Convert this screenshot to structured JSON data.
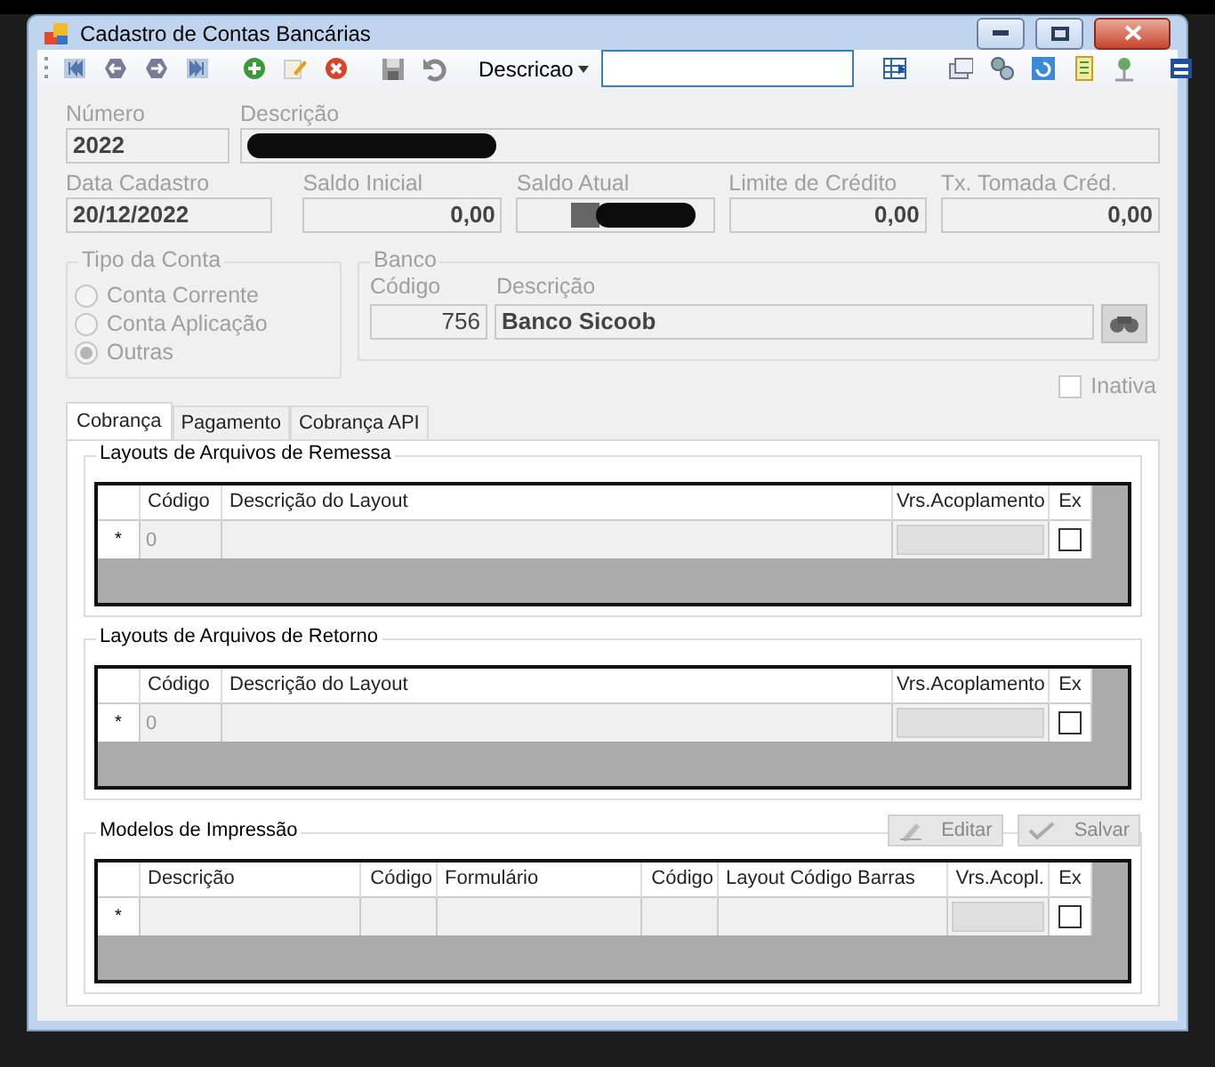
{
  "window": {
    "title": "Cadastro de Contas Bancárias"
  },
  "toolbar": {
    "search_field": {
      "label": "Descricao"
    }
  },
  "fields": [
    {
      "label": "Número",
      "kind": "text",
      "value": "2022"
    },
    {
      "label": "Descrição",
      "kind": "redacted"
    },
    {
      "label": "Data Cadastro",
      "kind": "text",
      "value": "20/12/2022"
    },
    {
      "label": "Saldo Inicial",
      "kind": "amount",
      "value": "0,00"
    },
    {
      "label": "Saldo Atual",
      "kind": "redacted"
    },
    {
      "label": "Limite de Crédito",
      "kind": "amount",
      "value": "0,00"
    },
    {
      "label": "Tx. Tomada Créd.",
      "kind": "amount",
      "value": "0,00"
    }
  ],
  "tipo_conta": {
    "title": "Tipo da Conta",
    "options": [
      {
        "label": "Conta Corrente",
        "selected": false
      },
      {
        "label": "Conta Aplicação",
        "selected": false
      },
      {
        "label": "Outras",
        "selected": true
      }
    ]
  },
  "banco": {
    "title": "Banco",
    "codigo_label": "Código",
    "descricao_label": "Descrição",
    "codigo": "756",
    "descricao": "Banco Sicoob"
  },
  "inativa": {
    "label": "Inativa",
    "checked": false
  },
  "tabs": [
    {
      "label": "Cobrança",
      "selected": true
    },
    {
      "label": "Pagamento",
      "selected": false
    },
    {
      "label": "Cobrança API",
      "selected": false
    }
  ],
  "grids": [
    {
      "title": "Layouts de Arquivos de Remessa",
      "columns": [
        {
          "label": "Código",
          "kind": "text"
        },
        {
          "label": "Descrição do Layout",
          "kind": "text"
        },
        {
          "label": "Vrs.Acoplamento",
          "kind": "combo"
        },
        {
          "label": "Ex",
          "kind": "check"
        }
      ],
      "new_row": {
        "marker": "*",
        "cells": [
          "0"
        ],
        "checked": false
      }
    },
    {
      "title": "Layouts de Arquivos de Retorno",
      "columns": [
        {
          "label": "Código",
          "kind": "text"
        },
        {
          "label": "Descrição do Layout",
          "kind": "text"
        },
        {
          "label": "Vrs.Acoplamento",
          "kind": "combo"
        },
        {
          "label": "Ex",
          "kind": "check"
        }
      ],
      "new_row": {
        "marker": "*",
        "cells": [
          "0"
        ],
        "checked": false
      }
    },
    {
      "title": "Modelos de Impressão",
      "buttons": [
        {
          "label": "Editar",
          "kind": "edit",
          "disabled": true
        },
        {
          "label": "Salvar",
          "kind": "save",
          "disabled": true
        }
      ],
      "columns": [
        {
          "label": "Descrição",
          "kind": "text"
        },
        {
          "label": "Código",
          "kind": "number"
        },
        {
          "label": "Formulário",
          "kind": "text"
        },
        {
          "label": "Código",
          "kind": "number"
        },
        {
          "label": "Layout Código Barras",
          "kind": "text"
        },
        {
          "label": "Vrs.Acopl.",
          "kind": "combo"
        },
        {
          "label": "Ex",
          "kind": "check"
        }
      ],
      "new_row": {
        "marker": "*",
        "checked": false
      }
    }
  ]
}
